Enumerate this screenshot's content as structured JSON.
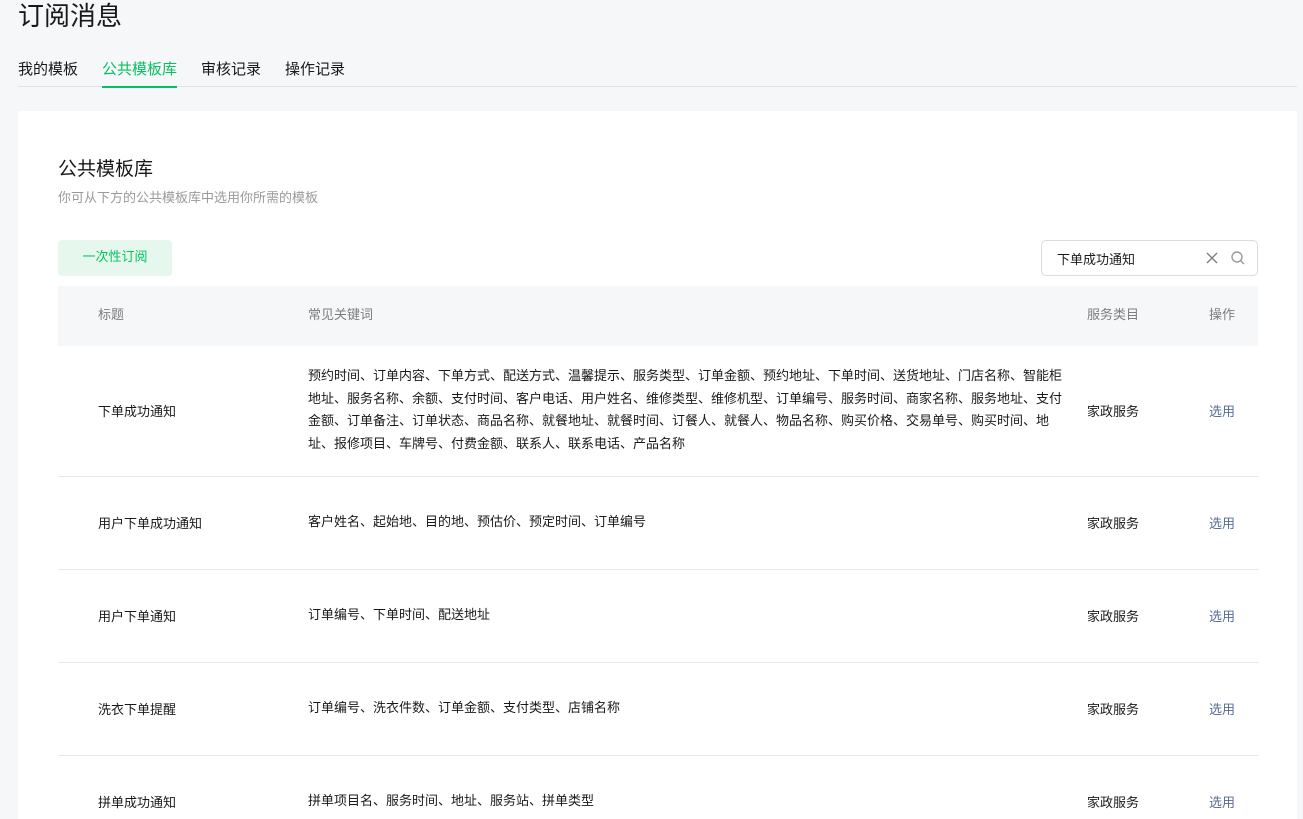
{
  "page": {
    "title": "订阅消息"
  },
  "tabs": [
    {
      "label": "我的模板",
      "active": false
    },
    {
      "label": "公共模板库",
      "active": true
    },
    {
      "label": "审核记录",
      "active": false
    },
    {
      "label": "操作记录",
      "active": false
    }
  ],
  "section": {
    "title": "公共模板库",
    "description": "你可从下方的公共模板库中选用你所需的模板"
  },
  "filter": {
    "type_label": "一次性订阅"
  },
  "search": {
    "value": "下单成功通知",
    "clear_icon": "close-icon",
    "search_icon": "search-icon"
  },
  "table": {
    "headers": {
      "title": "标题",
      "keywords": "常见关键词",
      "category": "服务类目",
      "action": "操作"
    },
    "rows": [
      {
        "title": "下单成功通知",
        "keywords": "预约时间、订单内容、下单方式、配送方式、温馨提示、服务类型、订单金额、预约地址、下单时间、送货地址、门店名称、智能柜地址、服务名称、余额、支付时间、客户电话、用户姓名、维修类型、维修机型、订单编号、服务时间、商家名称、服务地址、支付金额、订单备注、订单状态、商品名称、就餐地址、就餐时间、订餐人、就餐人、物品名称、购买价格、交易单号、购买时间、地址、报修项目、车牌号、付费金额、联系人、联系电话、产品名称",
        "category": "家政服务",
        "action": "选用"
      },
      {
        "title": "用户下单成功通知",
        "keywords": "客户姓名、起始地、目的地、预估价、预定时间、订单编号",
        "category": "家政服务",
        "action": "选用"
      },
      {
        "title": "用户下单通知",
        "keywords": "订单编号、下单时间、配送地址",
        "category": "家政服务",
        "action": "选用"
      },
      {
        "title": "洗衣下单提醒",
        "keywords": "订单编号、洗衣件数、订单金额、支付类型、店铺名称",
        "category": "家政服务",
        "action": "选用"
      },
      {
        "title": "拼单成功通知",
        "keywords": "拼单项目名、服务时间、地址、服务站、拼单类型",
        "category": "家政服务",
        "action": "选用"
      }
    ]
  },
  "colors": {
    "accent": "#07c160",
    "link": "#576b95",
    "accent_bg": "#e6f8ee"
  }
}
